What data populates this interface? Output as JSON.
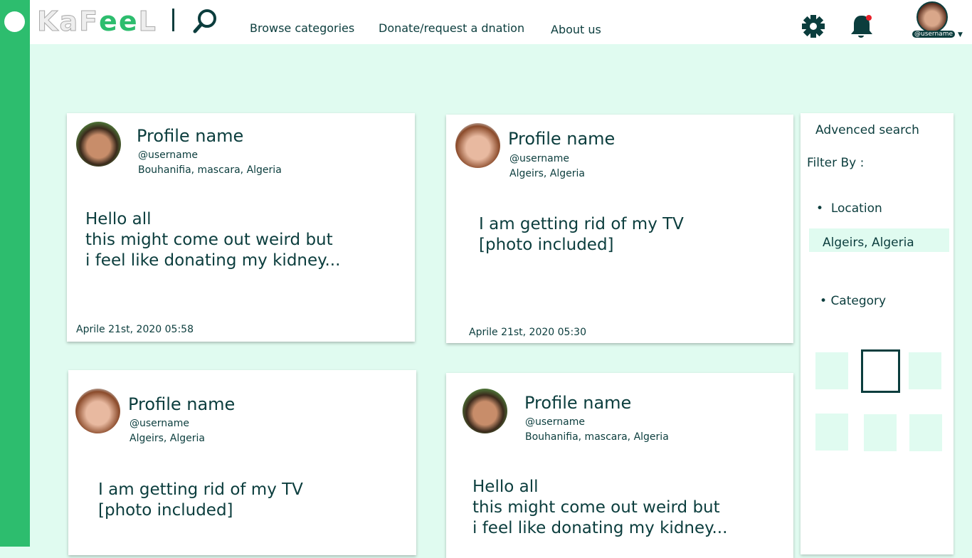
{
  "brand": {
    "logo_pre": "KaF",
    "logo_mid": "ee",
    "logo_post": "L"
  },
  "nav": [
    "Browse categories",
    "Donate/request a dnation",
    "About us"
  ],
  "user": {
    "username": "@username"
  },
  "colors": {
    "accent": "#2dbd6e",
    "text": "#0b3d3d",
    "background": "#e0fbf0",
    "notification": "#e8202a"
  },
  "posts": [
    {
      "name": "Profile name",
      "username": "@username",
      "location": "Bouhanifia, mascara, Algeria",
      "body": "Hello all\nthis might come out weird but\ni feel like donating my kidney...",
      "date": "Aprile 21st, 2020  05:58"
    },
    {
      "name": "Profile name",
      "username": "@username",
      "location": "Algeirs, Algeria",
      "body": "I am getting rid of my TV\n[photo included]",
      "date": "Aprile 21st, 2020  05:30"
    },
    {
      "name": "Profile name",
      "username": "@username",
      "location": "Algeirs, Algeria",
      "body": "I am getting rid of my TV\n[photo included]"
    },
    {
      "name": "Profile name",
      "username": "@username",
      "location": "Bouhanifia, mascara, Algeria",
      "body": "Hello all\nthis might come out weird but\ni feel like donating my kidney..."
    }
  ],
  "search": {
    "title": "Advenced search",
    "filter": "Filter By :",
    "location_label": "Location",
    "location_value": "Algeirs, Algeria",
    "category_label": "Category"
  }
}
